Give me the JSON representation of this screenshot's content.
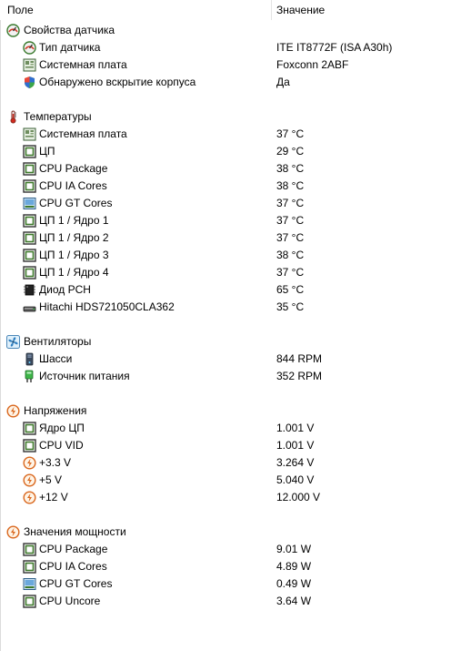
{
  "header": {
    "field": "Поле",
    "value": "Значение"
  },
  "rows": [
    {
      "kind": "group",
      "icon": "sensor-icon",
      "label": "Свойства датчика",
      "value": ""
    },
    {
      "kind": "item",
      "icon": "sensor-icon",
      "label": "Тип датчика",
      "value": "ITE IT8772F  (ISA A30h)"
    },
    {
      "kind": "item",
      "icon": "motherboard-icon",
      "label": "Системная плата",
      "value": "Foxconn 2ABF"
    },
    {
      "kind": "item",
      "icon": "shield-icon",
      "label": "Обнаружено вскрытие корпуса",
      "value": "Да"
    },
    {
      "kind": "group",
      "icon": "thermometer-icon",
      "label": "Температуры",
      "value": ""
    },
    {
      "kind": "item",
      "icon": "motherboard-icon",
      "label": "Системная плата",
      "value": "37 °C"
    },
    {
      "kind": "item",
      "icon": "chip-icon",
      "label": "ЦП",
      "value": "29 °C"
    },
    {
      "kind": "item",
      "icon": "chip-icon",
      "label": "CPU Package",
      "value": "38 °C"
    },
    {
      "kind": "item",
      "icon": "chip-icon",
      "label": "CPU IA Cores",
      "value": "38 °C"
    },
    {
      "kind": "item",
      "icon": "gpu-icon",
      "label": "CPU GT Cores",
      "value": "37 °C"
    },
    {
      "kind": "item",
      "icon": "chip-icon",
      "label": "ЦП 1 / Ядро 1",
      "value": "37 °C"
    },
    {
      "kind": "item",
      "icon": "chip-icon",
      "label": "ЦП 1 / Ядро 2",
      "value": "37 °C"
    },
    {
      "kind": "item",
      "icon": "chip-icon",
      "label": "ЦП 1 / Ядро 3",
      "value": "38 °C"
    },
    {
      "kind": "item",
      "icon": "chip-icon",
      "label": "ЦП 1 / Ядро 4",
      "value": "37 °C"
    },
    {
      "kind": "item",
      "icon": "pch-icon",
      "label": "Диод PCH",
      "value": "65 °C"
    },
    {
      "kind": "item",
      "icon": "hdd-icon",
      "label": "Hitachi HDS721050CLA362",
      "value": "35 °C"
    },
    {
      "kind": "group",
      "icon": "fan-icon",
      "label": "Вентиляторы",
      "value": ""
    },
    {
      "kind": "item",
      "icon": "case-icon",
      "label": "Шасси",
      "value": "844 RPM"
    },
    {
      "kind": "item",
      "icon": "psu-icon",
      "label": "Источник питания",
      "value": "352 RPM"
    },
    {
      "kind": "group",
      "icon": "voltage-icon",
      "label": "Напряжения",
      "value": ""
    },
    {
      "kind": "item",
      "icon": "chip-icon",
      "label": "Ядро ЦП",
      "value": "1.001 V"
    },
    {
      "kind": "item",
      "icon": "chip-icon",
      "label": "CPU VID",
      "value": "1.001 V"
    },
    {
      "kind": "item",
      "icon": "voltage-icon",
      "label": "+3.3 V",
      "value": "3.264 V"
    },
    {
      "kind": "item",
      "icon": "voltage-icon",
      "label": "+5 V",
      "value": "5.040 V"
    },
    {
      "kind": "item",
      "icon": "voltage-icon",
      "label": "+12 V",
      "value": "12.000 V"
    },
    {
      "kind": "group",
      "icon": "voltage-icon",
      "label": "Значения мощности",
      "value": ""
    },
    {
      "kind": "item",
      "icon": "chip-icon",
      "label": "CPU Package",
      "value": "9.01 W"
    },
    {
      "kind": "item",
      "icon": "chip-icon",
      "label": "CPU IA Cores",
      "value": "4.89 W"
    },
    {
      "kind": "item",
      "icon": "gpu-icon",
      "label": "CPU GT Cores",
      "value": "0.49 W"
    },
    {
      "kind": "item",
      "icon": "chip-icon",
      "label": "CPU Uncore",
      "value": "3.64 W"
    }
  ]
}
